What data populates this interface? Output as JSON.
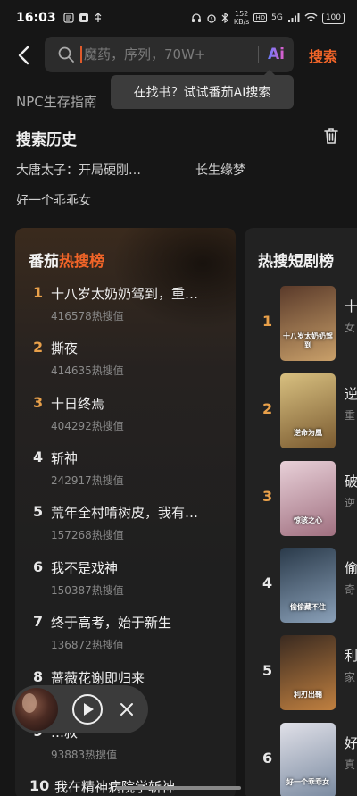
{
  "status_bar": {
    "time": "16:03",
    "speed_value": "152",
    "speed_unit": "KB/s",
    "hd": "HD",
    "network": "5G",
    "battery": "100"
  },
  "search": {
    "placeholder": "魔药，序列，70W+",
    "ai_label": "Ai",
    "button_label": "搜索"
  },
  "suggestion": "NPC生存指南",
  "tooltip": "在找书？试试番茄AI搜索",
  "history": {
    "title": "搜索历史",
    "items": [
      "大唐太子：开局硬刚…",
      "长生缘梦",
      "好一个乖乖女"
    ]
  },
  "hot_list": {
    "title_prefix": "番茄",
    "title_hot": "热搜榜",
    "items": [
      {
        "rank": "1",
        "title": "十八岁太奶奶驾到，重…",
        "score": "416578热搜值"
      },
      {
        "rank": "2",
        "title": "撕夜",
        "score": "414635热搜值"
      },
      {
        "rank": "3",
        "title": "十日终焉",
        "score": "404292热搜值"
      },
      {
        "rank": "4",
        "title": "斩神",
        "score": "242917热搜值"
      },
      {
        "rank": "5",
        "title": "荒年全村啃树皮，我有…",
        "score": "157268热搜值"
      },
      {
        "rank": "6",
        "title": "我不是戏神",
        "score": "150387热搜值"
      },
      {
        "rank": "7",
        "title": "终于高考，始于新生",
        "score": "136872热搜值"
      },
      {
        "rank": "8",
        "title": "蔷薇花谢即归来",
        "score": ""
      },
      {
        "rank": "9",
        "title": "…叔",
        "score": "93883热搜值"
      },
      {
        "rank": "10",
        "title": "我在精神病院学斩神",
        "score": ""
      }
    ]
  },
  "drama_list": {
    "title": "热搜短剧榜",
    "items": [
      {
        "rank": "1",
        "t1": "十",
        "t2": "女",
        "poster_text": "十八岁太奶奶驾到",
        "c1": "#5a3a2a",
        "c2": "#c9a06a"
      },
      {
        "rank": "2",
        "t1": "逆",
        "t2": "重",
        "poster_text": "逆命为凰",
        "c1": "#d8c080",
        "c2": "#7a5a30"
      },
      {
        "rank": "3",
        "t1": "破",
        "t2": "逆",
        "poster_text": "惊骇之心",
        "c1": "#e8d0d8",
        "c2": "#a07080"
      },
      {
        "rank": "4",
        "t1": "偷",
        "t2": "奇",
        "poster_text": "偷偷藏不住",
        "c1": "#2a3a4a",
        "c2": "#8aa0b8"
      },
      {
        "rank": "5",
        "t1": "利",
        "t2": "家",
        "poster_text": "利刃出鞘",
        "c1": "#3a2a20",
        "c2": "#c08040"
      },
      {
        "rank": "6",
        "t1": "好",
        "t2": "真",
        "poster_text": "好一个乖乖女",
        "c1": "#e0e0e8",
        "c2": "#7a8aa0"
      }
    ]
  }
}
